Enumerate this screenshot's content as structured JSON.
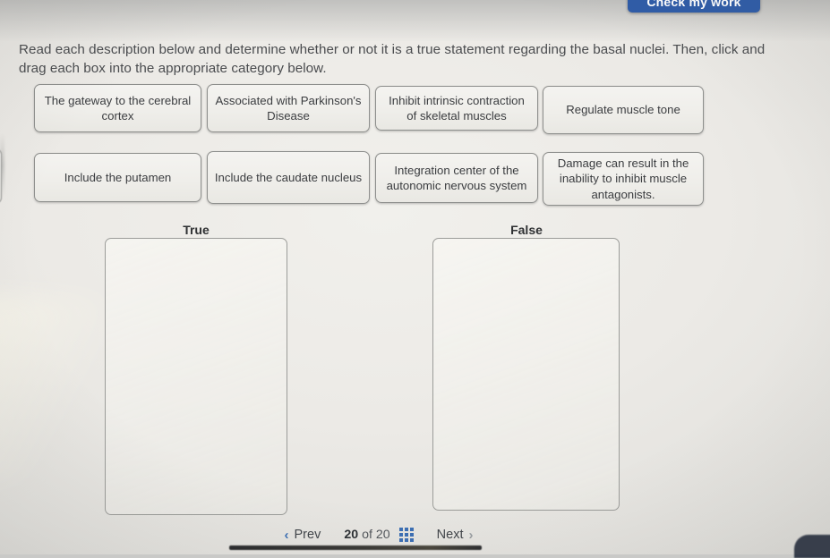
{
  "toolbar": {
    "check_my_work_label": "Check my work"
  },
  "instructions": {
    "text": "Read each description below and determine whether or not it is a true statement regarding the basal nuclei. Then, click and drag each box into the appropriate category below."
  },
  "tiles": [
    {
      "id": "tile-1",
      "label": "The gateway to the cerebral cortex"
    },
    {
      "id": "tile-2",
      "label": "Associated with Parkinson's Disease"
    },
    {
      "id": "tile-3",
      "label": "Inhibit intrinsic contraction of skeletal muscles"
    },
    {
      "id": "tile-4",
      "label": "Regulate muscle tone"
    },
    {
      "id": "tile-5",
      "label": "Include the putamen"
    },
    {
      "id": "tile-6",
      "label": "Include the caudate nucleus"
    },
    {
      "id": "tile-7",
      "label": "Integration center of the autonomic nervous system"
    },
    {
      "id": "tile-8",
      "label": "Damage can result in the inability to inhibit muscle antagonists."
    }
  ],
  "drop_zones": [
    {
      "id": "zone-true",
      "label": "True",
      "items": []
    },
    {
      "id": "zone-false",
      "label": "False",
      "items": []
    }
  ],
  "navigation": {
    "prev_label": "Prev",
    "next_label": "Next",
    "current_page": "20",
    "of_label": "of",
    "total_pages": "20",
    "grid_icon": "grid-3x3-icon",
    "prev_chevron": "chevron-left-icon",
    "next_chevron": "chevron-right-icon"
  },
  "colors": {
    "accent_blue": "#3c6fb4",
    "button_blue": "#2f5ca8",
    "tile_border": "#8e8f8d",
    "text_dark": "#3b3d40"
  }
}
